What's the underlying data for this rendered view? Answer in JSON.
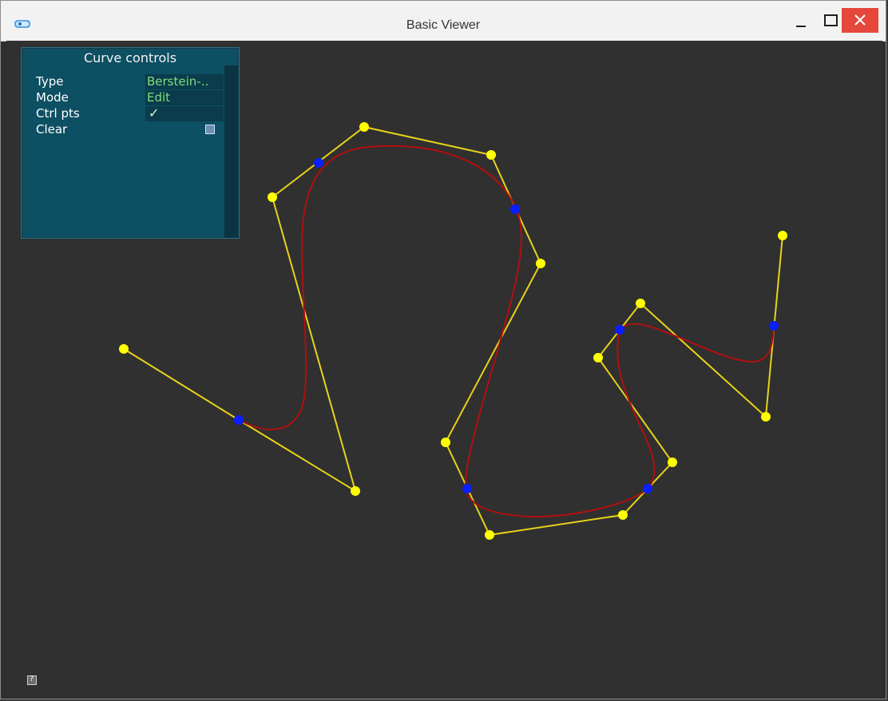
{
  "window": {
    "title": "Basic Viewer",
    "controls": [
      "minimize",
      "maximize",
      "close"
    ]
  },
  "panel": {
    "title": "Curve controls",
    "rows": [
      {
        "label": "Type",
        "value": "Berstein-.."
      },
      {
        "label": "Mode",
        "value": "Edit"
      },
      {
        "label": "Ctrl pts",
        "value": "✓"
      },
      {
        "label": "Clear",
        "value": ""
      }
    ]
  },
  "colors": {
    "control_polygon": "#e6d21a",
    "control_points": "#ffff00",
    "curve": "#b10f0f",
    "knots": "#0a1fff"
  },
  "icons": [
    "app-icon",
    "minimize-icon",
    "maximize-icon",
    "close-icon",
    "help-icon"
  ]
}
